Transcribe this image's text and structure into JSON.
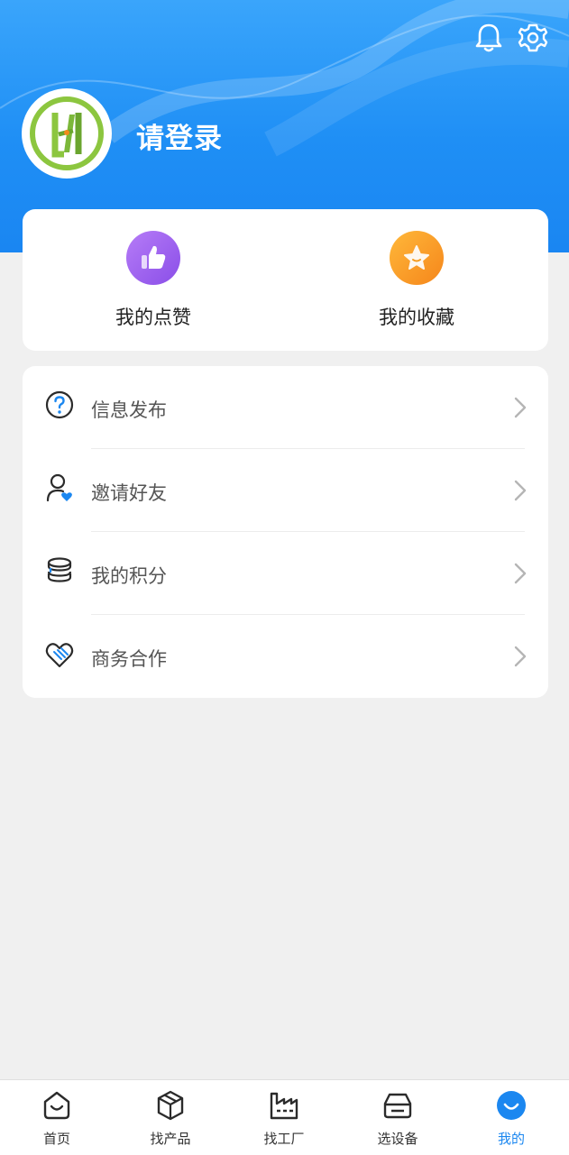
{
  "header": {
    "login_text": "请登录",
    "icons": {
      "notification": "bell-icon",
      "settings": "gear-icon"
    }
  },
  "quick_actions": [
    {
      "label": "我的点赞",
      "icon": "thumbs-up-icon",
      "color": "#9b5cf0"
    },
    {
      "label": "我的收藏",
      "icon": "star-icon",
      "color": "#f9a21b"
    }
  ],
  "menu": [
    {
      "label": "信息发布",
      "icon": "question-circle-icon"
    },
    {
      "label": "邀请好友",
      "icon": "user-heart-icon"
    },
    {
      "label": "我的积分",
      "icon": "coin-stack-icon"
    },
    {
      "label": "商务合作",
      "icon": "heart-handshake-icon"
    }
  ],
  "tabbar": [
    {
      "label": "首页",
      "icon": "home-icon",
      "active": false
    },
    {
      "label": "找产品",
      "icon": "box-icon",
      "active": false
    },
    {
      "label": "找工厂",
      "icon": "factory-icon",
      "active": false
    },
    {
      "label": "选设备",
      "icon": "device-icon",
      "active": false
    },
    {
      "label": "我的",
      "icon": "smile-icon",
      "active": true
    }
  ],
  "colors": {
    "primary": "#1b87f0",
    "header_top": "#3aa5fb",
    "background": "#f0f0f0"
  }
}
